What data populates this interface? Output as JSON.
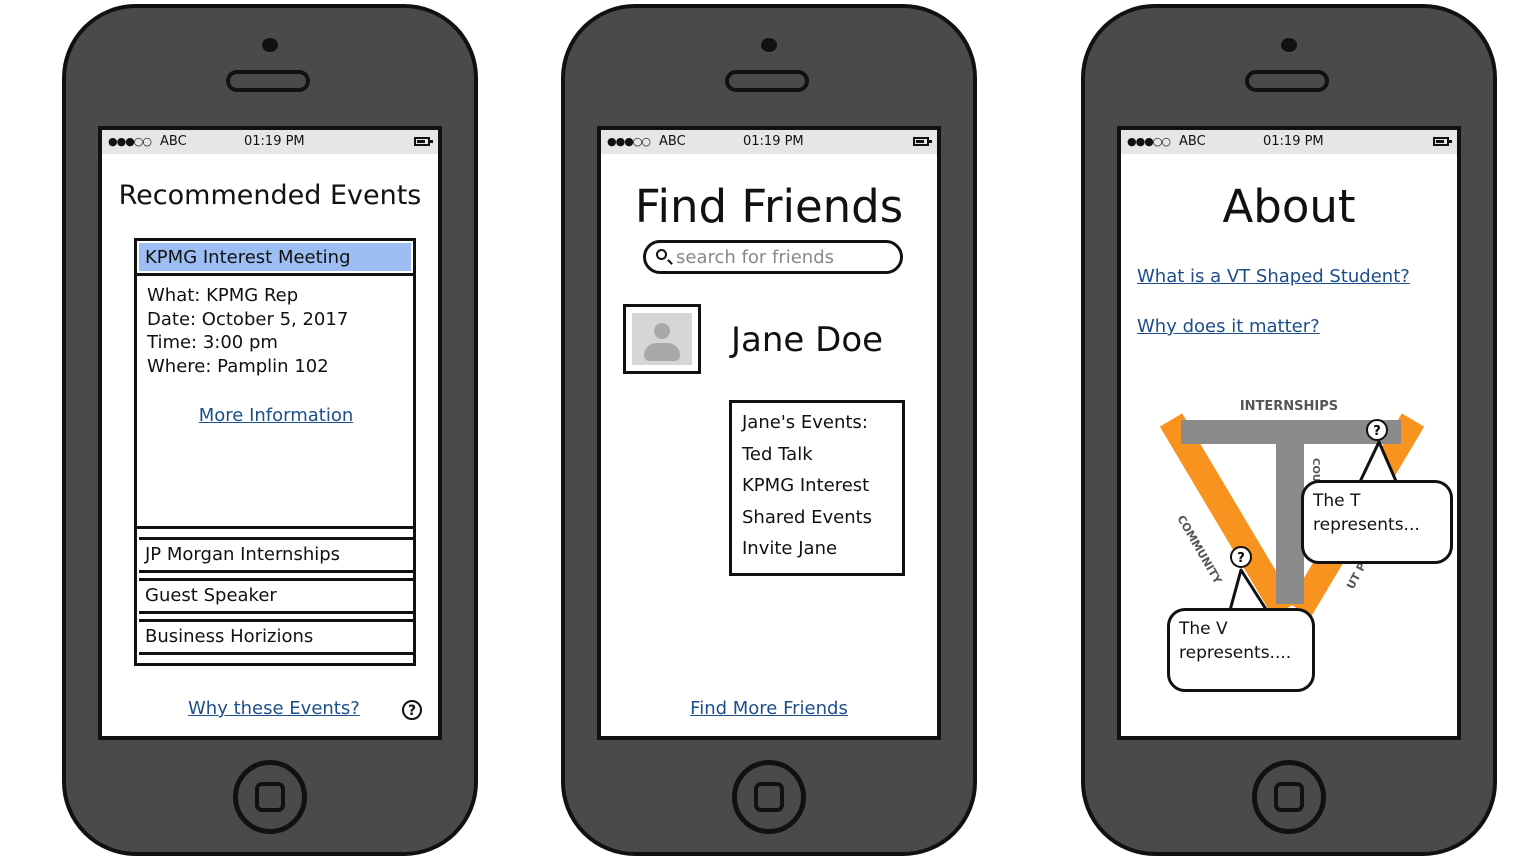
{
  "status_bar": {
    "signal": "●●●○○",
    "carrier": "ABC",
    "time": "01:19 PM"
  },
  "recommended": {
    "title": "Recommended Events",
    "selected": {
      "name": "KPMG Interest Meeting",
      "what": "What: KPMG Rep",
      "date": "Date: October 5, 2017",
      "time": "Time: 3:00 pm",
      "where": "Where: Pamplin 102",
      "more_link": "More Information"
    },
    "items": [
      "JP Morgan Internships",
      "Guest Speaker",
      "Business Horizions"
    ],
    "why_link": "Why these Events?",
    "help_glyph": "?"
  },
  "find_friends": {
    "title": "Find Friends",
    "search_placeholder": "search for friends",
    "friend_name": "Jane Doe",
    "events_heading": "Jane's Events:",
    "events": [
      "Ted Talk",
      "KPMG Interest",
      "Shared Events",
      "Invite Jane"
    ],
    "more_link": "Find More Friends"
  },
  "about": {
    "title": "About",
    "link1": "What is a VT Shaped Student?",
    "link2": "Why does it matter?",
    "diagram": {
      "label_top": "INTERNSHIPS",
      "label_left": "COMMUNITY",
      "label_mid": "COU",
      "label_right": "UT P",
      "colors": {
        "v": "#f7931e",
        "t": "#8a8a8a"
      }
    },
    "bubble_t": "The T represents...",
    "bubble_v": "The V represents....",
    "help_glyph": "?"
  }
}
